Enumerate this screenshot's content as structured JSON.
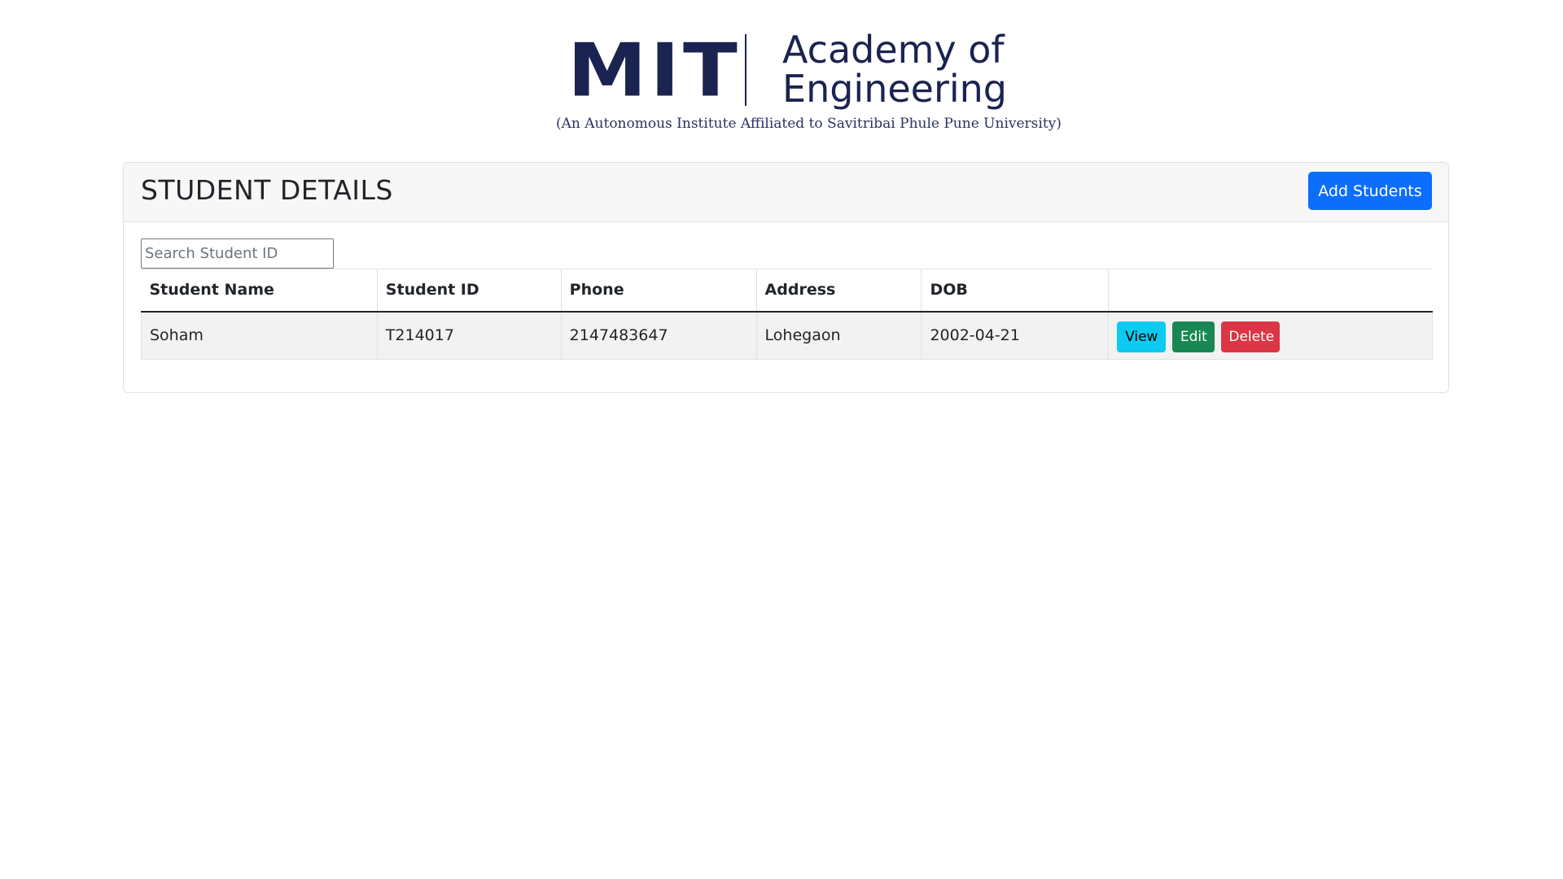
{
  "logo": {
    "mit": "MIT",
    "line1": "Academy of",
    "line2": "Engineering",
    "subtitle": "(An Autonomous Institute Affiliated to Savitribai Phule Pune University)"
  },
  "card": {
    "title": "STUDENT DETAILS",
    "add_button": "Add Students"
  },
  "search": {
    "placeholder": "Search Student ID",
    "value": ""
  },
  "table": {
    "headers": [
      "Student Name",
      "Student ID",
      "Phone",
      "Address",
      "DOB",
      ""
    ],
    "rows": [
      {
        "name": "Soham",
        "id": "T214017",
        "phone": "2147483647",
        "address": "Lohegaon",
        "dob": "2002-04-21",
        "actions": {
          "view": "View",
          "edit": "Edit",
          "delete": "Delete"
        }
      }
    ]
  },
  "colors": {
    "primary": "#0d6efd",
    "info": "#0dcaf0",
    "success": "#198754",
    "danger": "#dc3545",
    "logo_navy": "#1b2350"
  }
}
